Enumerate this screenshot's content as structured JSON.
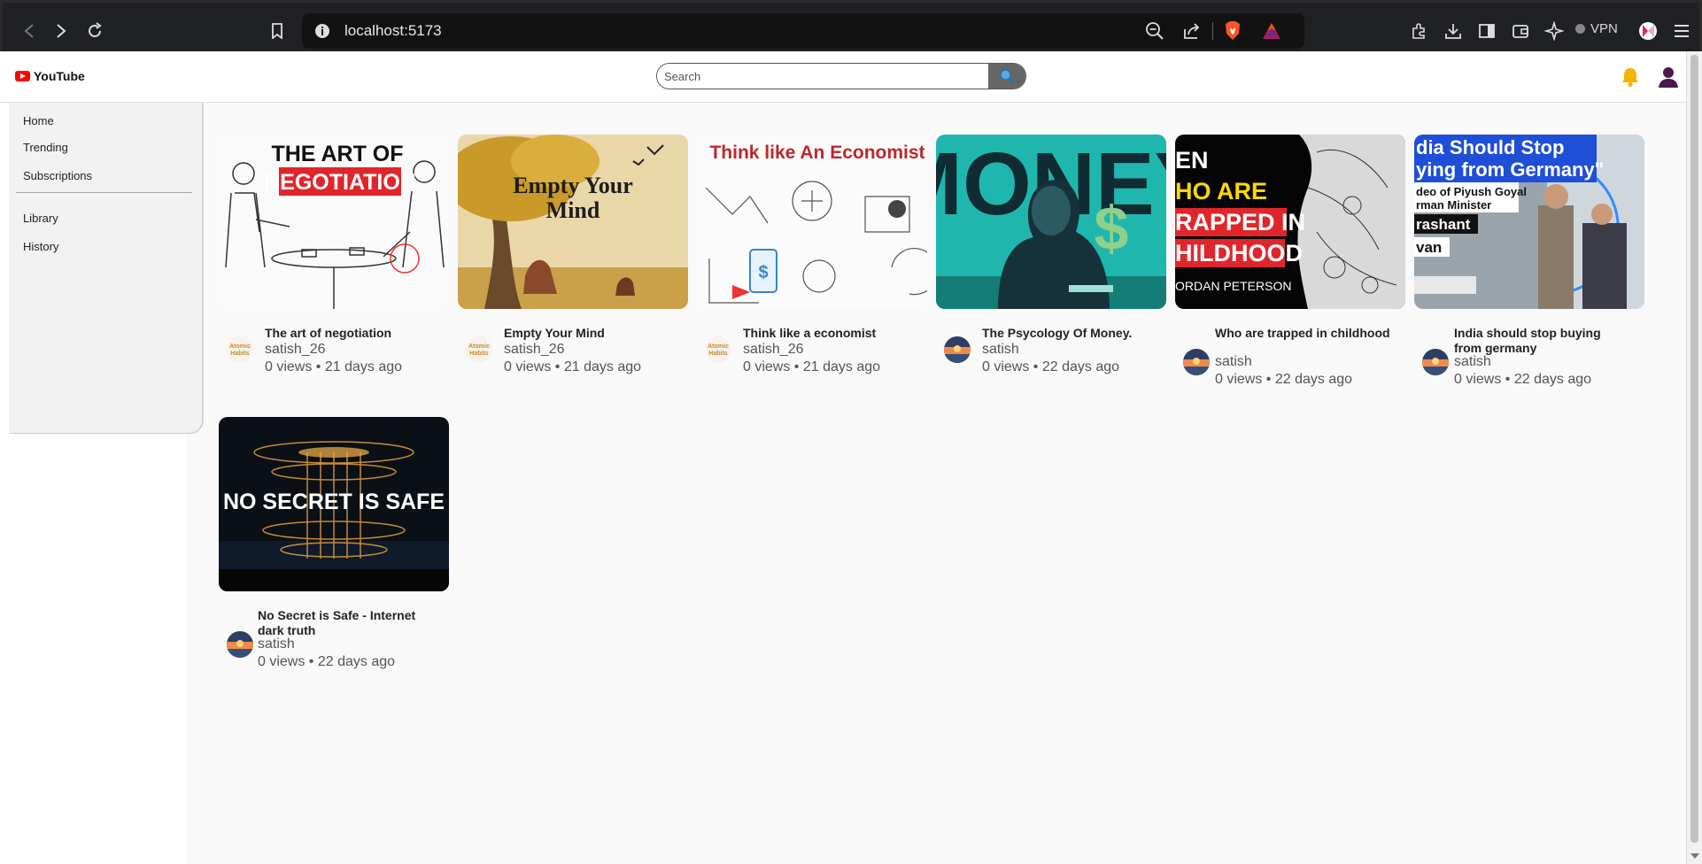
{
  "browser": {
    "url": "localhost:5173",
    "vpn_label": "VPN"
  },
  "app": {
    "logo_text": "YouTube",
    "search_placeholder": "Search"
  },
  "sidebar": {
    "items": [
      {
        "label": "Home"
      },
      {
        "label": "Trending"
      },
      {
        "label": "Subscriptions"
      },
      {
        "label": "Library"
      },
      {
        "label": "History"
      }
    ]
  },
  "videos": [
    {
      "title": "The art of negotiation",
      "channel": "satish_26",
      "stats": "0 views • 21 days ago",
      "thumb_text": [
        "THE ART OF",
        "NEGOTIATION"
      ],
      "avatar": "atomic-habits"
    },
    {
      "title": "Empty Your Mind",
      "channel": "satish_26",
      "stats": "0 views • 21 days ago",
      "thumb_text": [
        "Empty Your",
        "Mind"
      ],
      "avatar": "atomic-habits"
    },
    {
      "title": "Think like a economist",
      "channel": "satish_26",
      "stats": "0 views • 21 days ago",
      "thumb_text": [
        "Think like An Economist"
      ],
      "avatar": "atomic-habits"
    },
    {
      "title": "The Psycology Of Money.",
      "channel": "satish",
      "stats": "0 views • 22 days ago",
      "thumb_text": [
        "MONEY"
      ],
      "avatar": "sunset"
    },
    {
      "title": "Who are trapped in childhood",
      "channel": "satish",
      "stats": "0 views • 22 days ago",
      "thumb_text": [
        "EN",
        "HO ARE",
        "RAPPED IN",
        "HILDHOOD",
        "ORDAN PETERSON"
      ],
      "avatar": "sunset"
    },
    {
      "title": "India should stop buying from germany",
      "channel": "satish",
      "stats": "0 views • 22 days ago",
      "thumb_text": [
        "dia Should Stop",
        "ying from Germany\"",
        "deo of Piyush Goyal",
        "rman Minister",
        "rashant",
        "van"
      ],
      "avatar": "sunset"
    },
    {
      "title": "No Secret is Safe - Internet dark truth",
      "channel": "satish",
      "stats": "0 views • 22 days ago",
      "thumb_text": [
        "NO SECRET IS SAFE"
      ],
      "avatar": "sunset"
    }
  ],
  "avatar_text": {
    "line1": "Atomic",
    "line2": "Habits"
  },
  "colors": {
    "accent_red": "#ff0000",
    "bell": "#f5b400",
    "user": "#4a1a4a"
  }
}
